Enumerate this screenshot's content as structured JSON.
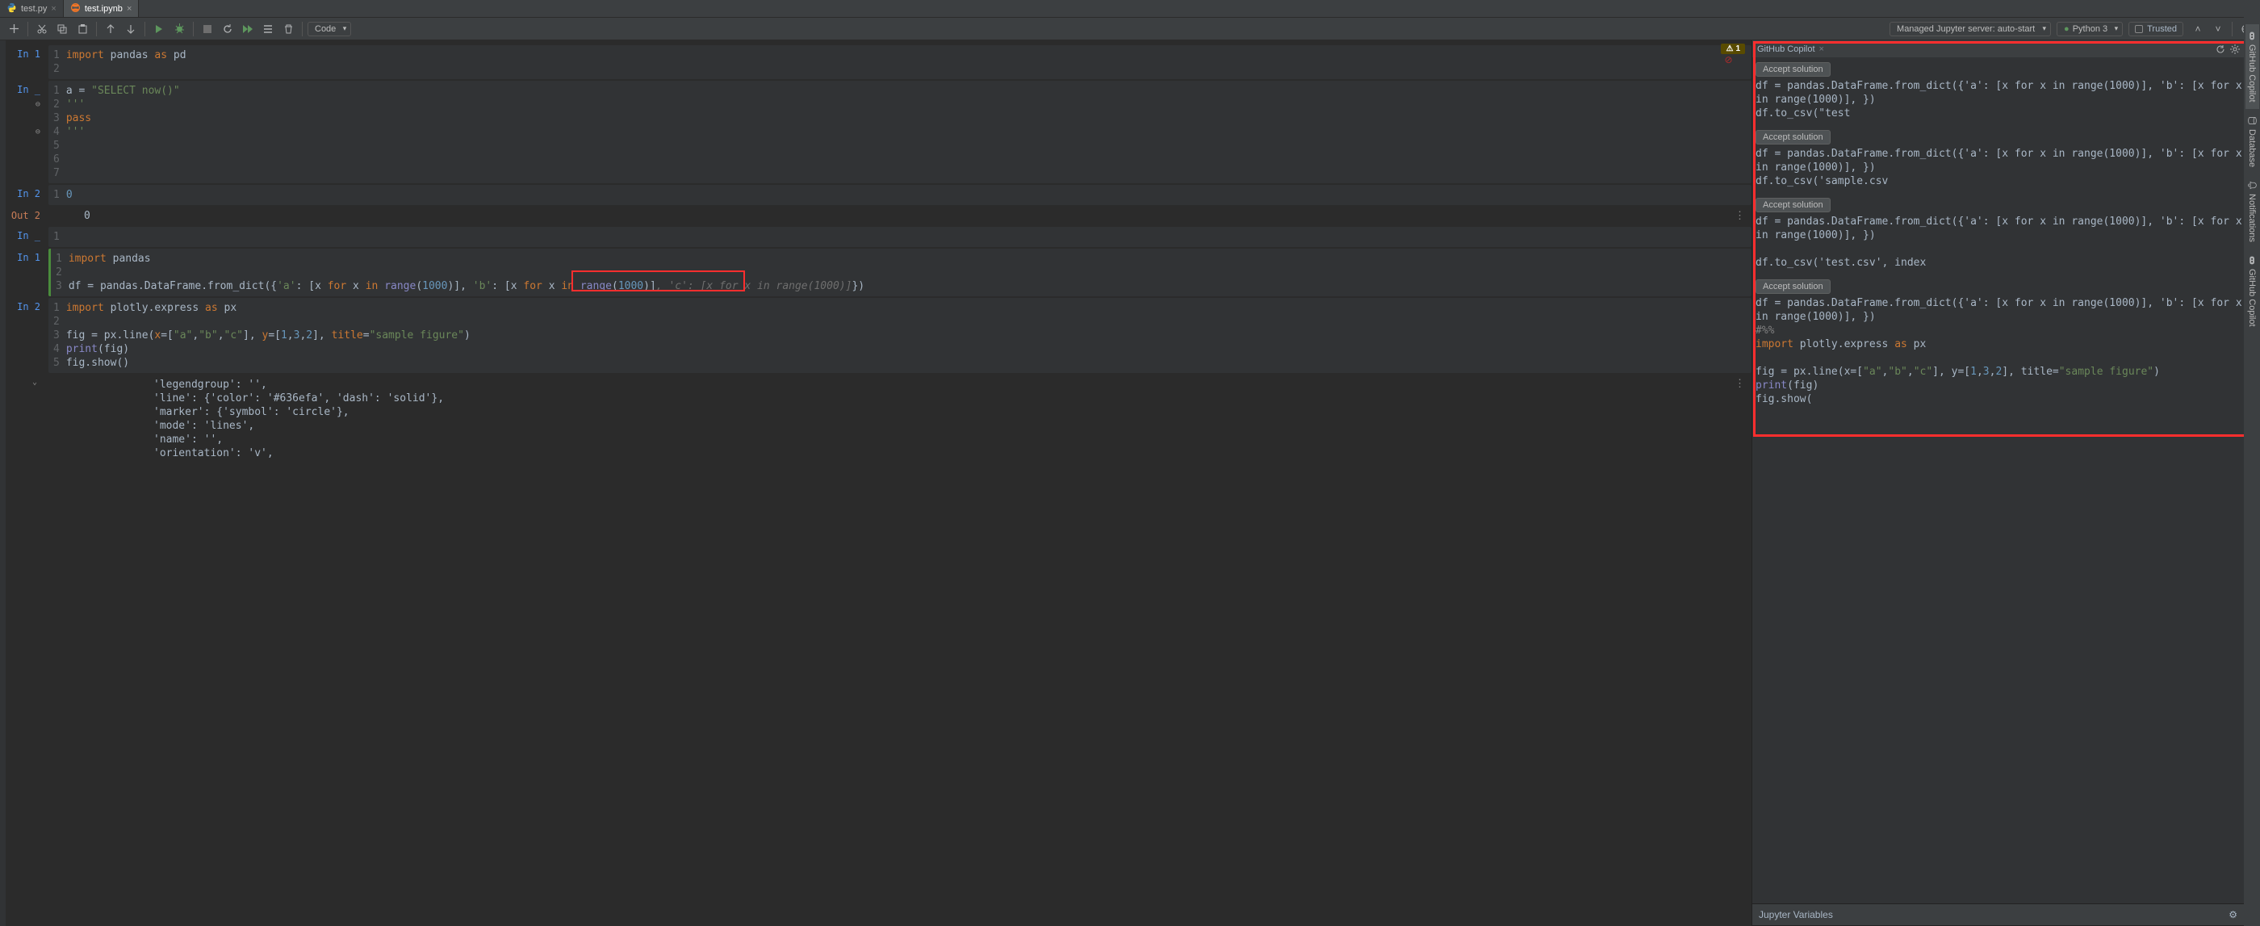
{
  "tabs": [
    {
      "label": "test.py",
      "active": false,
      "icon": "python-icon"
    },
    {
      "label": "test.ipynb",
      "active": true,
      "icon": "jupyter-icon"
    }
  ],
  "toolbar": {
    "cell_type": "Code",
    "server_label": "Managed Jupyter server: auto-start",
    "kernel": "Python 3",
    "trusted": "Trusted",
    "warn_badge": "1"
  },
  "cells": [
    {
      "type": "code",
      "prompt": "In 1",
      "label_class": "in",
      "lines": [
        {
          "n": "1",
          "html": "<span class='kw'>import</span> pandas <span class='kw'>as</span> pd"
        },
        {
          "n": "2",
          "html": ""
        }
      ]
    },
    {
      "type": "code",
      "prompt": "In _",
      "label_class": "in",
      "gutter_marks": [
        1,
        3
      ],
      "lines": [
        {
          "n": "1",
          "html": "a = <span class='str'>\"SELECT now()\"</span>"
        },
        {
          "n": "2",
          "html": "<span class='str'>'''</span>"
        },
        {
          "n": "3",
          "html": "<span class='kw'>pass</span>"
        },
        {
          "n": "4",
          "html": "<span class='str'>'''</span>"
        },
        {
          "n": "5",
          "html": ""
        },
        {
          "n": "6",
          "html": ""
        },
        {
          "n": "7",
          "html": ""
        }
      ]
    },
    {
      "type": "code",
      "prompt": "In 2",
      "label_class": "in",
      "lines": [
        {
          "n": "1",
          "html": "<span class='num'>0</span>"
        }
      ]
    },
    {
      "type": "output",
      "prompt": "Out 2",
      "label_class": "out",
      "text": "0",
      "overflow": true
    },
    {
      "type": "code",
      "prompt": "In _",
      "label_class": "in",
      "lines": [
        {
          "n": "1",
          "html": ""
        }
      ]
    },
    {
      "type": "code",
      "prompt": "In 1",
      "label_class": "in",
      "active": true,
      "lines": [
        {
          "n": "1",
          "html": "<span class='kw'>import</span> pandas"
        },
        {
          "n": "2",
          "html": ""
        },
        {
          "n": "3",
          "html": "df = pandas.DataFrame.from_dict({<span class='str'>'a'</span>: [x <span class='kw'>for</span> x <span class='kw'>in</span> <span class='bI'>range</span>(<span class='num'>1000</span>)], <span class='str'>'b'</span>: [x <span class='kw'>for</span> x <span class='kw'>in</span> <span class='bI'>range</span>(<span class='num'>1000</span>)]<span class='ghost'>, 'c': [x for x in range(1000)]</span>})"
        }
      ]
    },
    {
      "type": "code",
      "prompt": "In 2",
      "label_class": "in",
      "lines": [
        {
          "n": "1",
          "html": "<span class='kw'>import</span> plotly.express <span class='kw'>as</span> px"
        },
        {
          "n": "2",
          "html": ""
        },
        {
          "n": "3",
          "html": "fig = px.line(<span class='par'>x</span>=[<span class='str'>\"a\"</span>,<span class='str'>\"b\"</span>,<span class='str'>\"c\"</span>], <span class='par'>y</span>=[<span class='num'>1</span>,<span class='num'>3</span>,<span class='num'>2</span>], <span class='par'>title</span>=<span class='str'>\"sample figure\"</span>)"
        },
        {
          "n": "4",
          "html": "<span class='bI'>print</span>(fig)"
        },
        {
          "n": "5",
          "html": "fig.show()"
        }
      ]
    },
    {
      "type": "output",
      "prompt": "",
      "label_class": "",
      "fold": true,
      "overflow": true,
      "lines_out": [
        "'legendgroup': '',",
        "'line': {'color': '#636efa', 'dash': 'solid'},",
        "'marker': {'symbol': 'circle'},",
        "'mode': 'lines',",
        "'name': '',",
        "'orientation': 'v',"
      ]
    }
  ],
  "copilot": {
    "panel_title": "GitHub Copilot",
    "accept_label": "Accept solution",
    "solutions": [
      [
        "df = pandas.DataFrame.from_dict({'a': [x for x in range(1000)], 'b': [x for x in range(1000)], })",
        "df.to_csv(\"test"
      ],
      [
        "df = pandas.DataFrame.from_dict({'a': [x for x in range(1000)], 'b': [x for x in range(1000)], })",
        "df.to_csv('sample.csv"
      ],
      [
        "df = pandas.DataFrame.from_dict({'a': [x for x in range(1000)], 'b': [x for x in range(1000)], })",
        "",
        "df.to_csv('test.csv', index"
      ],
      [
        "<span style='color:#a9b7c6'>df = pandas.DataFrame.from_dict({'a': [x for x in range(1000)], 'b': [x for x in range(1000)], })</span>",
        "<span style='color:#808080'>#%%</span>",
        "<span class='kw'>import</span> plotly.express <span class='kw'>as</span> px",
        "",
        "fig = px.line(x=[<span class='str'>\"a\"</span>,<span class='str'>\"b\"</span>,<span class='str'>\"c\"</span>], y=[<span class='num'>1</span>,<span class='num'>3</span>,<span class='num'>2</span>], title=<span class='str'>\"sample figure\"</span>)",
        "<span class='bI'>print</span>(fig)",
        "fig.show("
      ]
    ]
  },
  "jupyter_vars": {
    "title": "Jupyter Variables"
  },
  "edge_tabs": [
    {
      "label": "GitHub Copilot",
      "active": true,
      "icon": "copilot-icon"
    },
    {
      "label": "Database",
      "active": false,
      "icon": "database-icon"
    },
    {
      "label": "Notifications",
      "active": false,
      "icon": "bell-icon"
    },
    {
      "label": "GitHub Copilot",
      "active": false,
      "icon": "copilot-icon"
    }
  ]
}
